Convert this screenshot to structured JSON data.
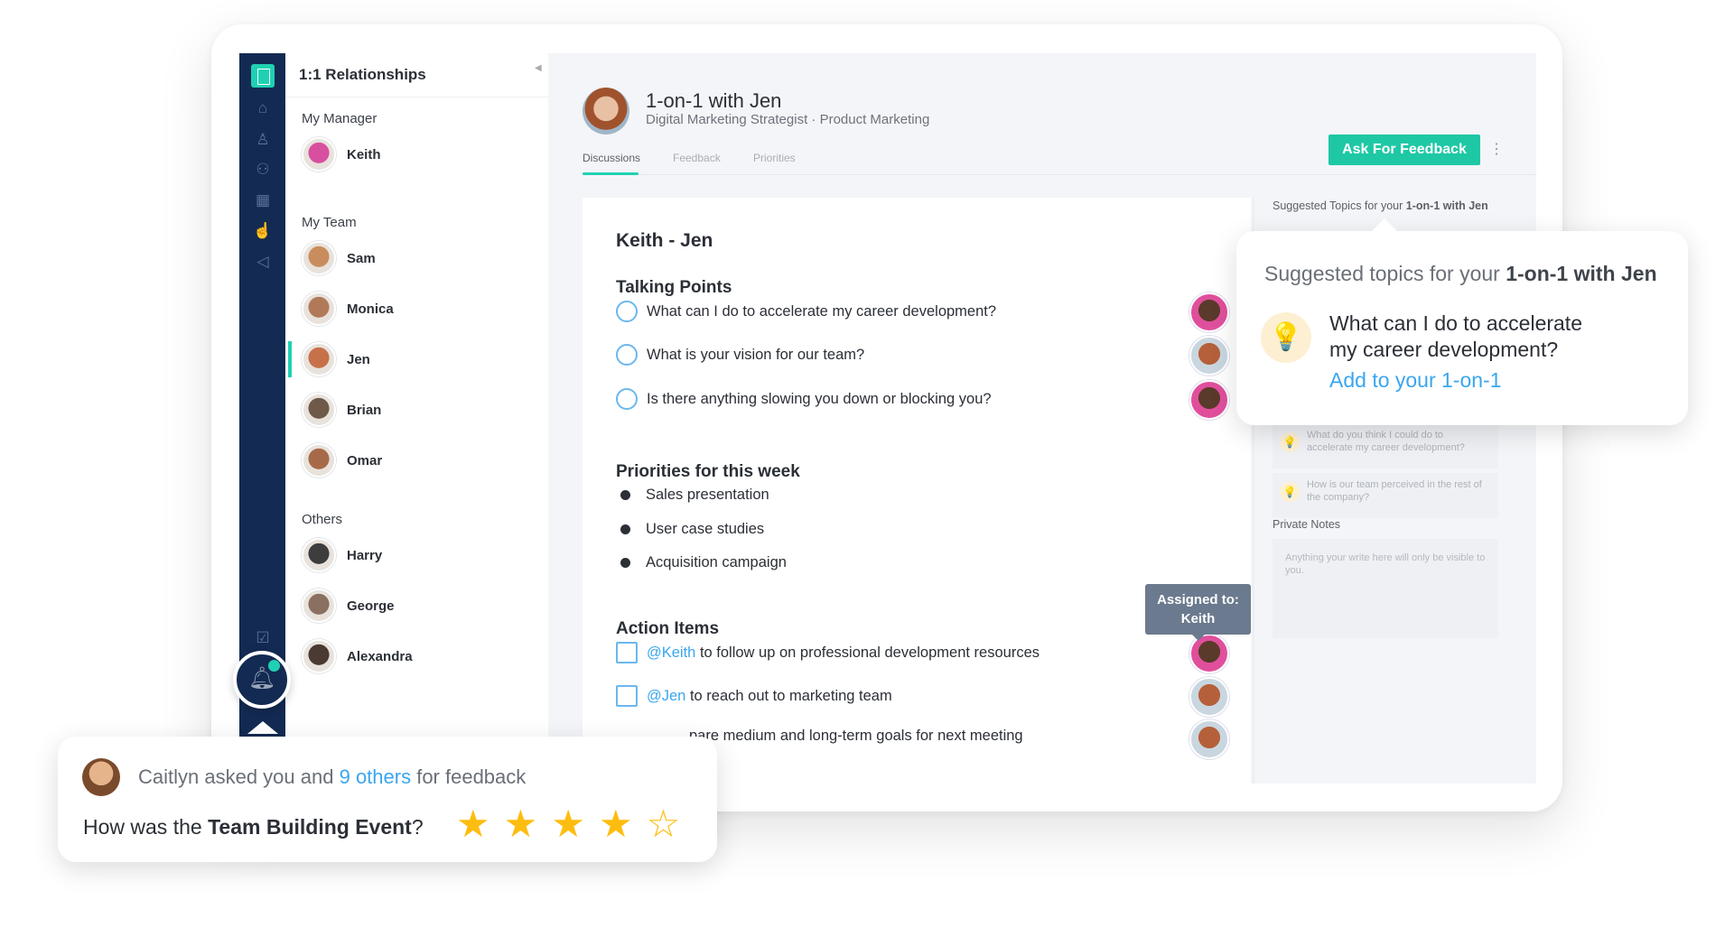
{
  "sidebar": {
    "title": "1:1 Relationships",
    "groups": [
      {
        "label": "My Manager",
        "people": [
          {
            "name": "Keith"
          }
        ]
      },
      {
        "label": "My Team",
        "people": [
          {
            "name": "Sam"
          },
          {
            "name": "Monica"
          },
          {
            "name": "Jen",
            "active": true
          },
          {
            "name": "Brian"
          },
          {
            "name": "Omar"
          }
        ]
      },
      {
        "label": "Others",
        "people": [
          {
            "name": "Harry"
          },
          {
            "name": "George"
          },
          {
            "name": "Alexandra"
          }
        ]
      }
    ],
    "nav_icons": [
      "home-icon",
      "user-icon",
      "users-icon",
      "calendar-icon",
      "thumbs-up-icon",
      "megaphone-icon",
      "checkbox-icon",
      "bell-icon"
    ]
  },
  "header": {
    "title": "1-on-1 with Jen",
    "subtitle": "Digital Marketing Strategist · Product Marketing",
    "ask_button": "Ask For Feedback",
    "tabs": [
      {
        "label": "Discussions",
        "active": true
      },
      {
        "label": "Feedback"
      },
      {
        "label": "Priorities"
      }
    ]
  },
  "card": {
    "title": "Keith - Jen",
    "talking_points_heading": "Talking Points",
    "talking_points": [
      "What can I do to accelerate my career development?",
      "What is your vision for our team?",
      "Is there anything slowing you down or blocking you?"
    ],
    "priorities_heading": "Priorities for this week",
    "priorities": [
      "Sales presentation",
      "User case studies",
      "Acquisition campaign"
    ],
    "action_heading": "Action Items",
    "actions": [
      {
        "mention": "@Keith",
        "text": " to follow up on professional development resources"
      },
      {
        "mention": "@Jen",
        "text": " to reach out to marketing team"
      },
      {
        "mention": "",
        "text": "pare medium and long-term goals for next meeting"
      }
    ],
    "tooltip": {
      "line1": "Assigned to:",
      "line2": "Keith"
    }
  },
  "right_panel": {
    "title_prefix": "Suggested Topics for your ",
    "title_bold": "1-on-1 with Jen",
    "suggestions": [
      "What do you think I could do to accelerate my career development?",
      "How is our team perceived in the rest of the company?"
    ],
    "notes_label": "Private Notes",
    "notes_placeholder": "Anything your write here will only be visible to you."
  },
  "popup": {
    "heading_prefix": "Suggested topics for your ",
    "heading_bold": "1-on-1 with Jen",
    "question": "What can I do to accelerate my career development?",
    "add_link": "Add to your 1-on-1"
  },
  "feedback": {
    "name": "Caitlyn",
    "mid": " asked you and ",
    "link": "9 others",
    "end": " for feedback",
    "q_prefix": "How was the ",
    "q_bold": "Team Building Event",
    "q_end": "?",
    "rating": 4,
    "max_rating": 5
  },
  "colors": {
    "accent": "#1fd1b2",
    "nav": "#132a52",
    "link": "#3aa6ee",
    "star": "#fdbd10"
  }
}
